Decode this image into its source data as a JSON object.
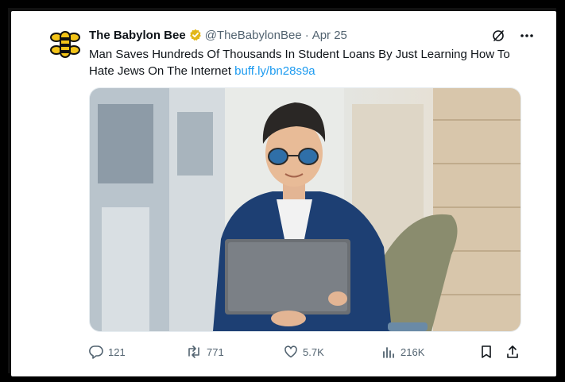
{
  "tweet": {
    "author_name": "The Babylon Bee",
    "handle": "@TheBabylonBee",
    "separator": "·",
    "date": "Apr 25",
    "text": "Man Saves Hundreds Of Thousands In Student Loans By Just Learning How To Hate Jews On The Internet",
    "link": "buff.ly/bn28s9a"
  },
  "metrics": {
    "replies": "121",
    "retweets": "771",
    "likes": "5.7K",
    "views": "216K"
  },
  "colors": {
    "verified": "#e2b719",
    "link": "#1d9bf0",
    "muted": "#536471"
  },
  "icons": [
    "bee-logo-icon",
    "verified-badge-icon",
    "grok-icon",
    "more-icon",
    "reply-icon",
    "retweet-icon",
    "like-icon",
    "views-icon",
    "bookmark-icon",
    "share-icon"
  ]
}
